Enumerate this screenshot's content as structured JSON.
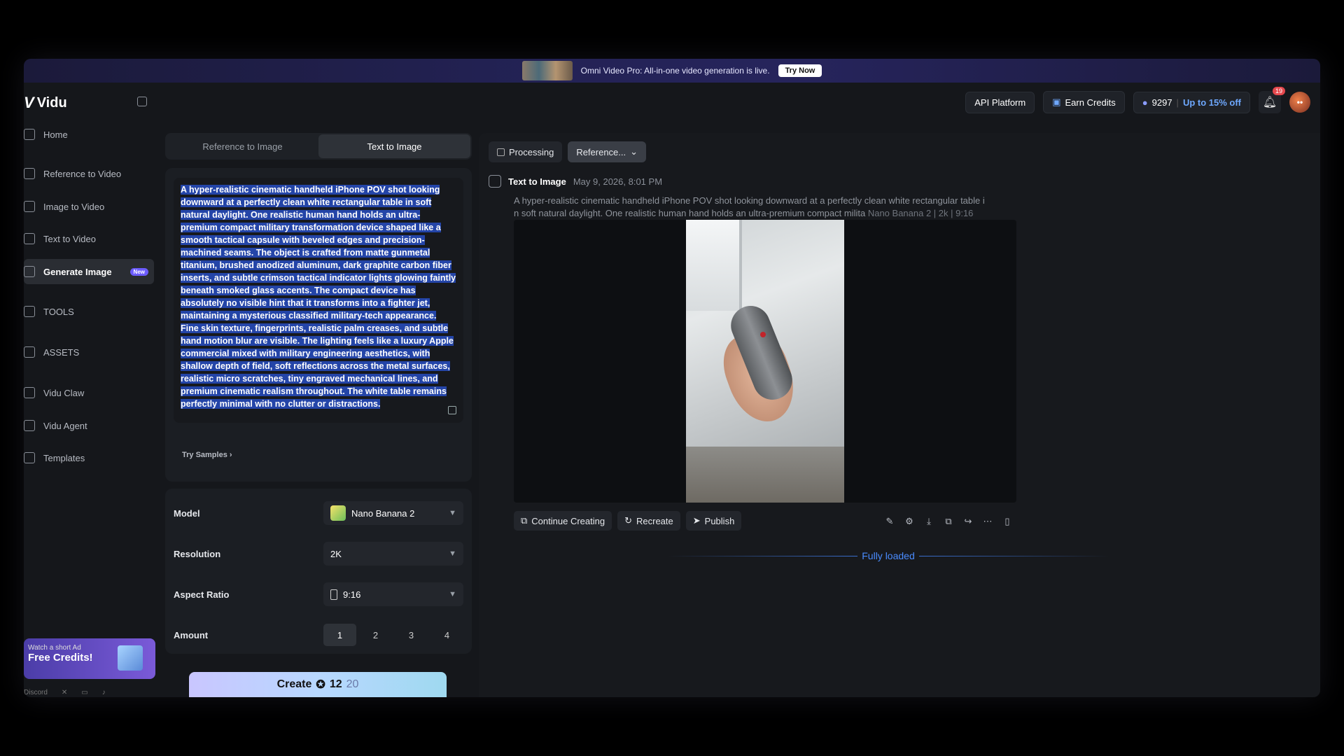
{
  "banner": {
    "text": "Omni Video Pro: All-in-one video generation is live.",
    "cta": "Try Now"
  },
  "app": {
    "logo": "Vidu"
  },
  "topbar": {
    "api_platform": "API Platform",
    "earn_credits": "Earn Credits",
    "credits": "9297",
    "discount": "Up to 15% off",
    "notifications": "19"
  },
  "sidebar": {
    "items": [
      {
        "label": "Home",
        "icon": "home-icon"
      },
      {
        "label": "Reference to Video",
        "icon": "reference-video-icon"
      },
      {
        "label": "Image to Video",
        "icon": "image-video-icon"
      },
      {
        "label": "Text to Video",
        "icon": "text-video-icon"
      },
      {
        "label": "Generate Image",
        "icon": "image-icon",
        "badge": "New",
        "active": true
      },
      {
        "label": "TOOLS",
        "icon": "tools-icon"
      },
      {
        "label": "ASSETS",
        "icon": "assets-icon"
      },
      {
        "label": "Vidu Claw",
        "icon": "claw-icon"
      },
      {
        "label": "Vidu Agent",
        "icon": "agent-icon"
      },
      {
        "label": "Templates",
        "icon": "templates-icon"
      }
    ],
    "promo": {
      "line1": "Watch a short Ad",
      "line2": "Free Credits!"
    },
    "footer": {
      "discord": "Discord"
    }
  },
  "panel": {
    "tabs": [
      "Reference to Image",
      "Text to Image"
    ],
    "active_tab": "Text to Image",
    "prompt": "A hyper-realistic cinematic handheld iPhone POV shot looking downward at a perfectly clean white rectangular table in soft natural daylight. One realistic human hand holds an ultra-premium compact military transformation device shaped like a smooth tactical capsule with beveled edges and precision-machined seams. The object is crafted from matte gunmetal titanium, brushed anodized aluminum, dark graphite carbon fiber inserts, and subtle crimson tactical indicator lights glowing faintly beneath smoked glass accents. The compact device has absolutely no visible hint that it transforms into a fighter jet, maintaining a mysterious classified military-tech appearance. Fine skin texture, fingerprints, realistic palm creases, and subtle hand motion blur are visible. The lighting feels like a luxury Apple commercial mixed with military engineering aesthetics, with shallow depth of field, soft reflections across the metal surfaces, realistic micro scratches, tiny engraved mechanical lines, and premium cinematic realism throughout. The white table remains perfectly minimal with no clutter or distractions.",
    "try_samples": "Try Samples",
    "settings": {
      "model_label": "Model",
      "model_value": "Nano Banana 2",
      "resolution_label": "Resolution",
      "resolution_value": "2K",
      "aspect_label": "Aspect Ratio",
      "aspect_value": "9:16",
      "amount_label": "Amount",
      "amount_options": [
        "1",
        "2",
        "3",
        "4"
      ],
      "amount_selected": "1"
    },
    "create": {
      "label": "Create",
      "cost": "12",
      "original_cost": "20"
    }
  },
  "main": {
    "filter_processing": "Processing",
    "filter_reference": "Reference...",
    "generation": {
      "type": "Text to Image",
      "date": "May 9, 2026, 8:01 PM",
      "prompt_line1": "A hyper-realistic cinematic handheld iPhone POV shot looking downward at a perfectly clean white rectangular table i",
      "prompt_line2": "n soft natural daylight. One realistic human hand holds an ultra-premium compact milita",
      "meta": "Nano Banana 2  |  2k  |  9:16"
    },
    "actions": {
      "continue": "Continue Creating",
      "recreate": "Recreate",
      "publish": "Publish"
    },
    "status": "Fully loaded"
  }
}
